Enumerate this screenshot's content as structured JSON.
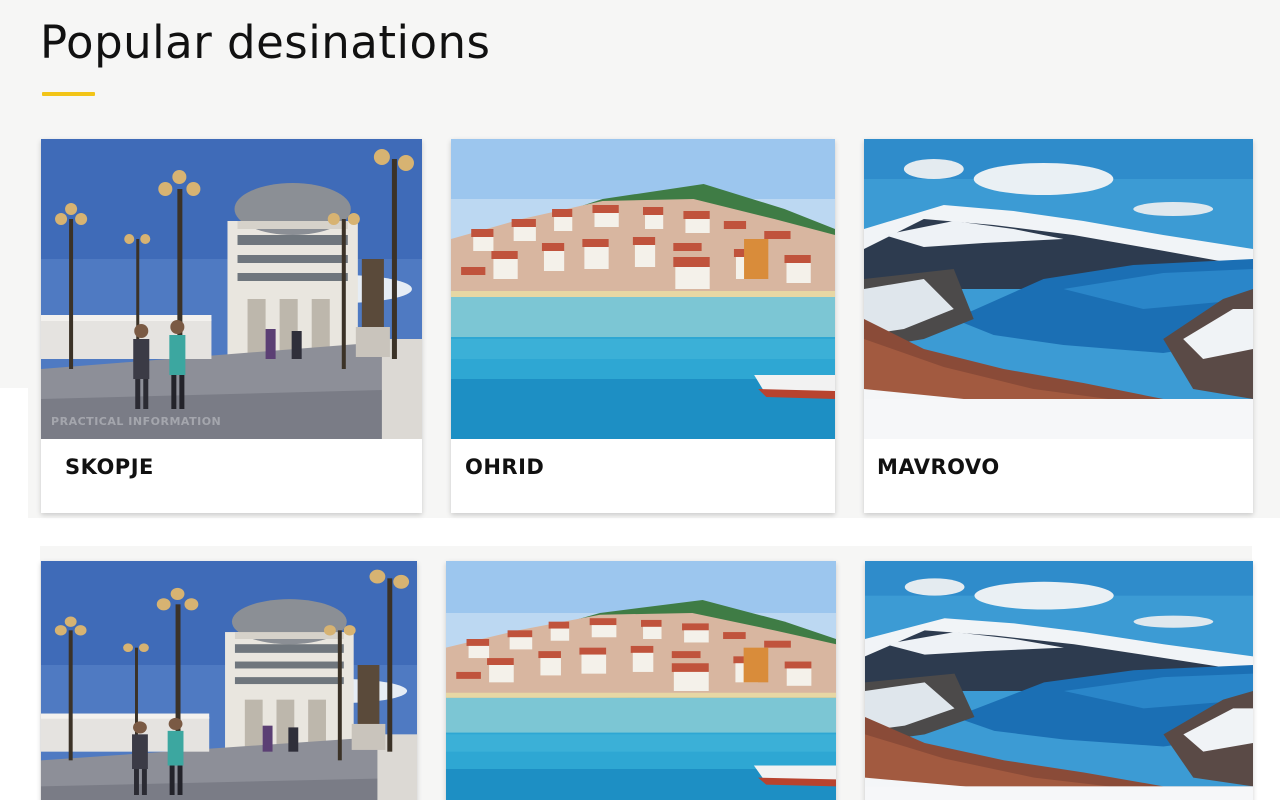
{
  "page": {
    "title": "Popular desinations",
    "accent_color": "#f2c417"
  },
  "destinations": [
    {
      "name": "SKOPJE",
      "image": "skopje-city-photo",
      "watermark": "PRACTICAL INFORMATION"
    },
    {
      "name": "OHRID",
      "image": "ohrid-lake-photo"
    },
    {
      "name": "MAVROVO",
      "image": "mavrovo-mountain-lake-photo"
    }
  ],
  "second_row": [
    {
      "image": "skopje-city-photo"
    },
    {
      "image": "ohrid-lake-photo"
    },
    {
      "image": "mavrovo-mountain-lake-photo"
    }
  ]
}
